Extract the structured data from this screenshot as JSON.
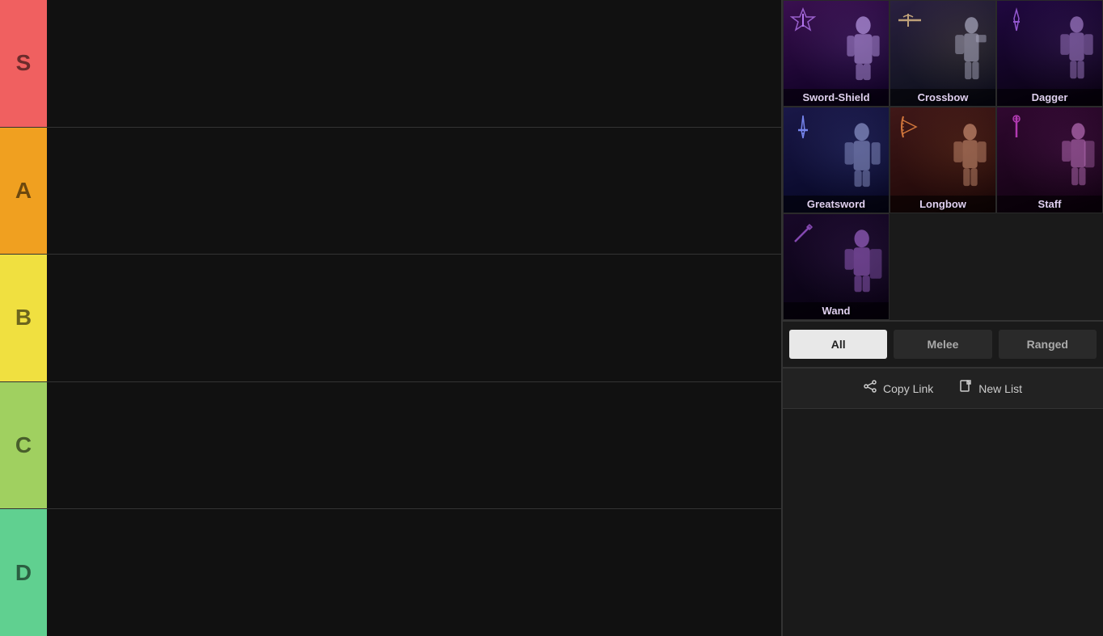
{
  "tiers": [
    {
      "id": "s",
      "label": "S",
      "color": "#f06060",
      "items": []
    },
    {
      "id": "a",
      "label": "A",
      "color": "#f0a020",
      "items": []
    },
    {
      "id": "b",
      "label": "B",
      "color": "#f0e040",
      "items": []
    },
    {
      "id": "c",
      "label": "C",
      "color": "#a0d060",
      "items": []
    },
    {
      "id": "d",
      "label": "D",
      "color": "#60d090",
      "items": []
    }
  ],
  "weapons": [
    {
      "id": "sword-shield",
      "name": "Sword-Shield",
      "icon": "⚔",
      "bgClass": "weapon-sword-shield"
    },
    {
      "id": "crossbow",
      "name": "Crossbow",
      "icon": "🏹",
      "bgClass": "weapon-crossbow"
    },
    {
      "id": "dagger",
      "name": "Dagger",
      "icon": "🗡",
      "bgClass": "weapon-dagger"
    },
    {
      "id": "greatsword",
      "name": "Greatsword",
      "icon": "⚔",
      "bgClass": "weapon-greatsword"
    },
    {
      "id": "longbow",
      "name": "Longbow",
      "icon": "🏹",
      "bgClass": "weapon-longbow"
    },
    {
      "id": "staff",
      "name": "Staff",
      "icon": "✦",
      "bgClass": "weapon-staff"
    },
    {
      "id": "wand",
      "name": "Wand",
      "icon": "✦",
      "bgClass": "weapon-wand"
    }
  ],
  "filters": [
    {
      "id": "all",
      "label": "All",
      "active": true
    },
    {
      "id": "melee",
      "label": "Melee",
      "active": false
    },
    {
      "id": "ranged",
      "label": "Ranged",
      "active": false
    }
  ],
  "actions": [
    {
      "id": "copy-link",
      "label": "Copy Link",
      "icon": "⬡"
    },
    {
      "id": "new-list",
      "label": "New List",
      "icon": "📄"
    }
  ]
}
